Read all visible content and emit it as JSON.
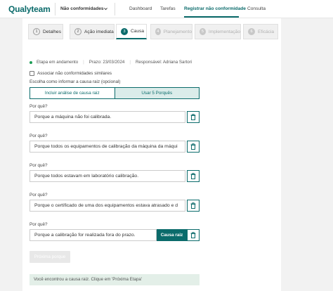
{
  "brand": {
    "logo_q": "Q",
    "logo_rest": "ualyteam"
  },
  "header": {
    "module": "Não conformidades",
    "nav": [
      "Dashboard",
      "Tarefas",
      "Registrar não conformidade",
      "Consulta"
    ],
    "active_nav_index": 2
  },
  "steps": [
    {
      "num": "1",
      "label": "Detalhes",
      "state": "done"
    },
    {
      "num": "2",
      "label": "Ação imediata",
      "state": "done"
    },
    {
      "num": "3",
      "label": "Causa",
      "state": "active"
    },
    {
      "num": "4",
      "label": "Planejamento",
      "state": "disabled"
    },
    {
      "num": "5",
      "label": "Implementação",
      "state": "disabled"
    },
    {
      "num": "6",
      "label": "Eficácia",
      "state": "disabled"
    }
  ],
  "status": {
    "stage": "Etapa em andamento",
    "deadline": "Prazo: 23/03/2024",
    "owner": "Responsável: Adriana Sartori"
  },
  "form": {
    "associate_label": "Associar não conformidades similares",
    "associate_checked": false,
    "choose_label": "Escolha como informar a causa raiz (opcional)",
    "option_left": "Incluir análise de causa raiz",
    "option_right": "Usar 5 Porquês",
    "selected_option": "Usar 5 Porquês",
    "whys": [
      {
        "label": "Por quê?",
        "value": "Porque a máquina não foi calibrada."
      },
      {
        "label": "Por quê?",
        "value": "Porque todos os equipamentos de calibração da máquina da máqui"
      },
      {
        "label": "Por quê?",
        "value": "Porque todos estavam em laboratório calibração."
      },
      {
        "label": "Por quê?",
        "value": "Porque o certificado de uma dos equipamentos estava atrasado e d"
      },
      {
        "label": "Por quê?",
        "value": "Porque a calibração for realizada fora do prazo."
      }
    ],
    "root_cause_button": "Causa raiz",
    "next_button": "Próxima porque",
    "info_message": "Você encontrou a causa raiz. Clique em 'Próxima Etapa'"
  },
  "colors": {
    "brand": "#0b6b6b",
    "status_dot": "#1e9e57",
    "info_bg": "#e3efe8"
  }
}
